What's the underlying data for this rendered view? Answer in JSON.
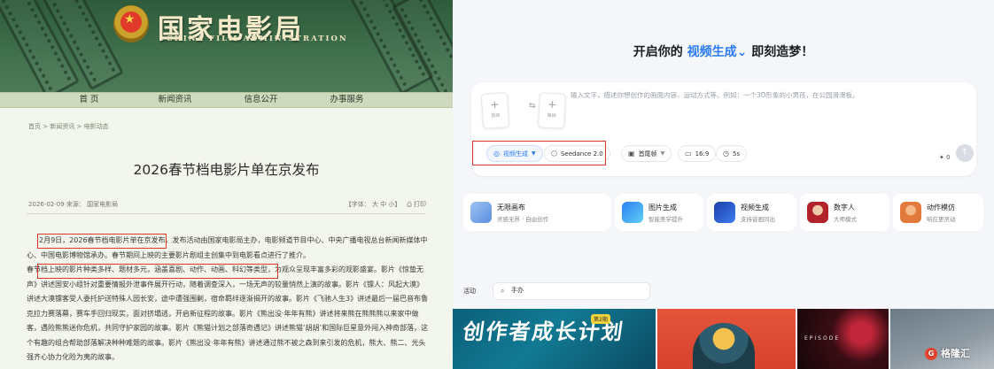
{
  "left_page": {
    "site_title": "国家电影局",
    "site_subtitle": "CHINA FILM ADMINISTRATION",
    "nav": [
      "首 页",
      "新闻资讯",
      "信息公开",
      "办事服务"
    ],
    "breadcrumb": "首页 > 新闻资讯 > 电影动态",
    "article_title": "2026春节档电影片单在京发布",
    "meta_left": "2026-02-09 来源：  国家电影局",
    "meta_font_label": "【字体：",
    "meta_font_sizes": [
      "大",
      "中",
      "小"
    ],
    "meta_font_close": "】",
    "print_label": "打印",
    "paragraph1_highlight": "2月9日，2026春节档电影片单在京发布",
    "paragraph1_rest": "。发布活动由国家电影局主办，电影频道节目中心、中央广播电视总台新闻新媒体中心、中国电影博物馆承办。春节期间上映的主要影片剧组主创集中到电影看点进行了推介。",
    "paragraph2_highlight": "春节档上映的影片种类多样、题材多元，涵盖喜剧、动作、动画、科幻等类型",
    "paragraph2_rest": "，为观众呈现丰富多彩的观影盛宴。影片《惊蛰无声》讲述国安小组针对重要情报外泄事件展开行动，随着调查深入，一场无声的较量悄然上演的故事。影片《镖人：风起大漠》讲述大漠镖客受人委托护送特殊人园长安，途中遭强围剿，宿命羁绊逐渐揭开的故事。影片《飞驰人生3》讲述最后一届巴音布鲁克拉力赛落幕，赛车手回归现实，面对挤塌逃，开启新征程的故事。影片《熊出没·年年有熊》讲述将来熊在熊熊熊以来家中做客，遇险熊熊迷你危机，共同守护家园的故事。影片《熊猫计划之部落奇遇记》讲述熊猫‘胡胡’和国际巨星意外闯入神奇部落，这个有趣的组合帮助部落解决种种难题的故事。影片《熊出没·年年有熊》讲述通过熊不被之森到来引发的危机，熊大、熊二、光头强齐心协力化险为夷的故事。"
  },
  "right_page": {
    "headline_prefix": "开启你的",
    "headline_mode": "视频生成",
    "headline_suffix": "即刻造梦！",
    "upload_first": "首帧",
    "upload_last": "尾帧",
    "prompt_placeholder": "输入文字，描述你想创作的画面内容、运动方式等。例如：一个3D形象的小男孩，在公园滑滑板。",
    "chips": {
      "mode": "视频生成",
      "model": "Seedance 2.0",
      "frame": "首尾帧",
      "ratio": "16:9",
      "duration": "5s"
    },
    "credits": "0",
    "features": [
      {
        "title": "无限画布",
        "sub": "灵感无界 · 自由创作"
      },
      {
        "title": "图片生成",
        "sub": "智能美学提升"
      },
      {
        "title": "视频生成",
        "sub": "支持音画同出"
      },
      {
        "title": "数字人",
        "sub": "大师模式"
      },
      {
        "title": "动作模仿",
        "sub": "响应更灵动"
      }
    ],
    "activity_label": "活动",
    "activity_search_value": "手办",
    "tile1_text": "创作者成长计划",
    "tile1_badge": "第2期",
    "tile3_text": "EPISODE",
    "watermark": "格隆汇",
    "watermark_logo": "G"
  },
  "colors": {
    "accent_blue": "#2a7cf6",
    "highlight_red": "#e0352b",
    "banner_green": "#3f6f4c"
  }
}
